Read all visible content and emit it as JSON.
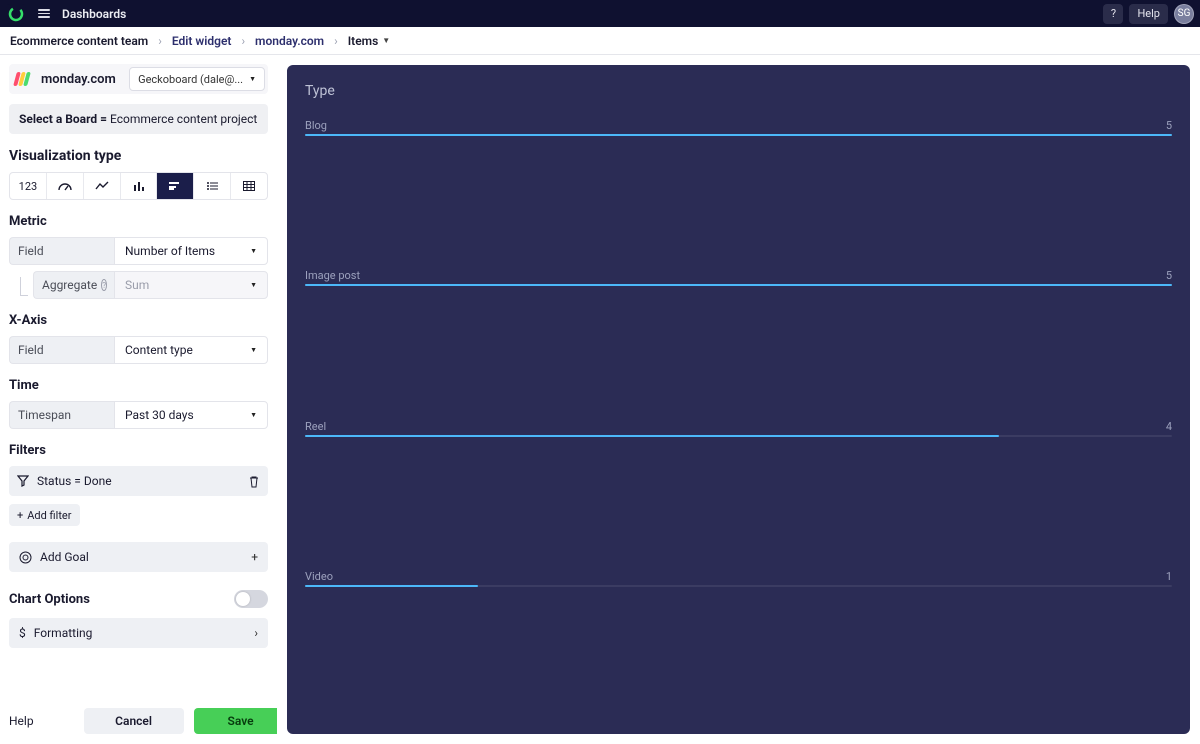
{
  "header": {
    "title": "Dashboards",
    "help_label": "Help",
    "question_label": "?",
    "avatar_initials": "SG"
  },
  "breadcrumb": {
    "items": [
      "Ecommerce content team",
      "Edit widget",
      "monday.com",
      "Items"
    ]
  },
  "integration": {
    "name": "monday.com",
    "account": "Geckoboard (dale@..."
  },
  "board": {
    "label": "Select a Board",
    "value": "Ecommerce content project"
  },
  "viz": {
    "section": "Visualization type",
    "types": [
      "123",
      "gauge",
      "line",
      "column",
      "bar",
      "leaderboard",
      "table"
    ],
    "active_index": 4
  },
  "metric": {
    "section": "Metric",
    "field_label": "Field",
    "field_value": "Number of Items",
    "agg_label": "Aggregate",
    "agg_value": "Sum"
  },
  "xaxis": {
    "section": "X-Axis",
    "field_label": "Field",
    "field_value": "Content type"
  },
  "time": {
    "section": "Time",
    "field_label": "Timespan",
    "field_value": "Past 30 days"
  },
  "filters": {
    "section": "Filters",
    "items": [
      "Status = Done"
    ],
    "add_label": "Add filter"
  },
  "goal": {
    "label": "Add Goal"
  },
  "chart_options": {
    "section": "Chart Options"
  },
  "formatting": {
    "label": "Formatting"
  },
  "footer": {
    "help": "Help",
    "cancel": "Cancel",
    "save": "Save"
  },
  "widget": {
    "title": "Type"
  },
  "chart_data": {
    "type": "bar",
    "categories": [
      "Blog",
      "Image post",
      "Reel",
      "Video"
    ],
    "values": [
      5,
      5,
      4,
      1
    ],
    "title": "Type",
    "xlabel": "",
    "ylabel": "",
    "ylim": [
      0,
      5
    ]
  }
}
